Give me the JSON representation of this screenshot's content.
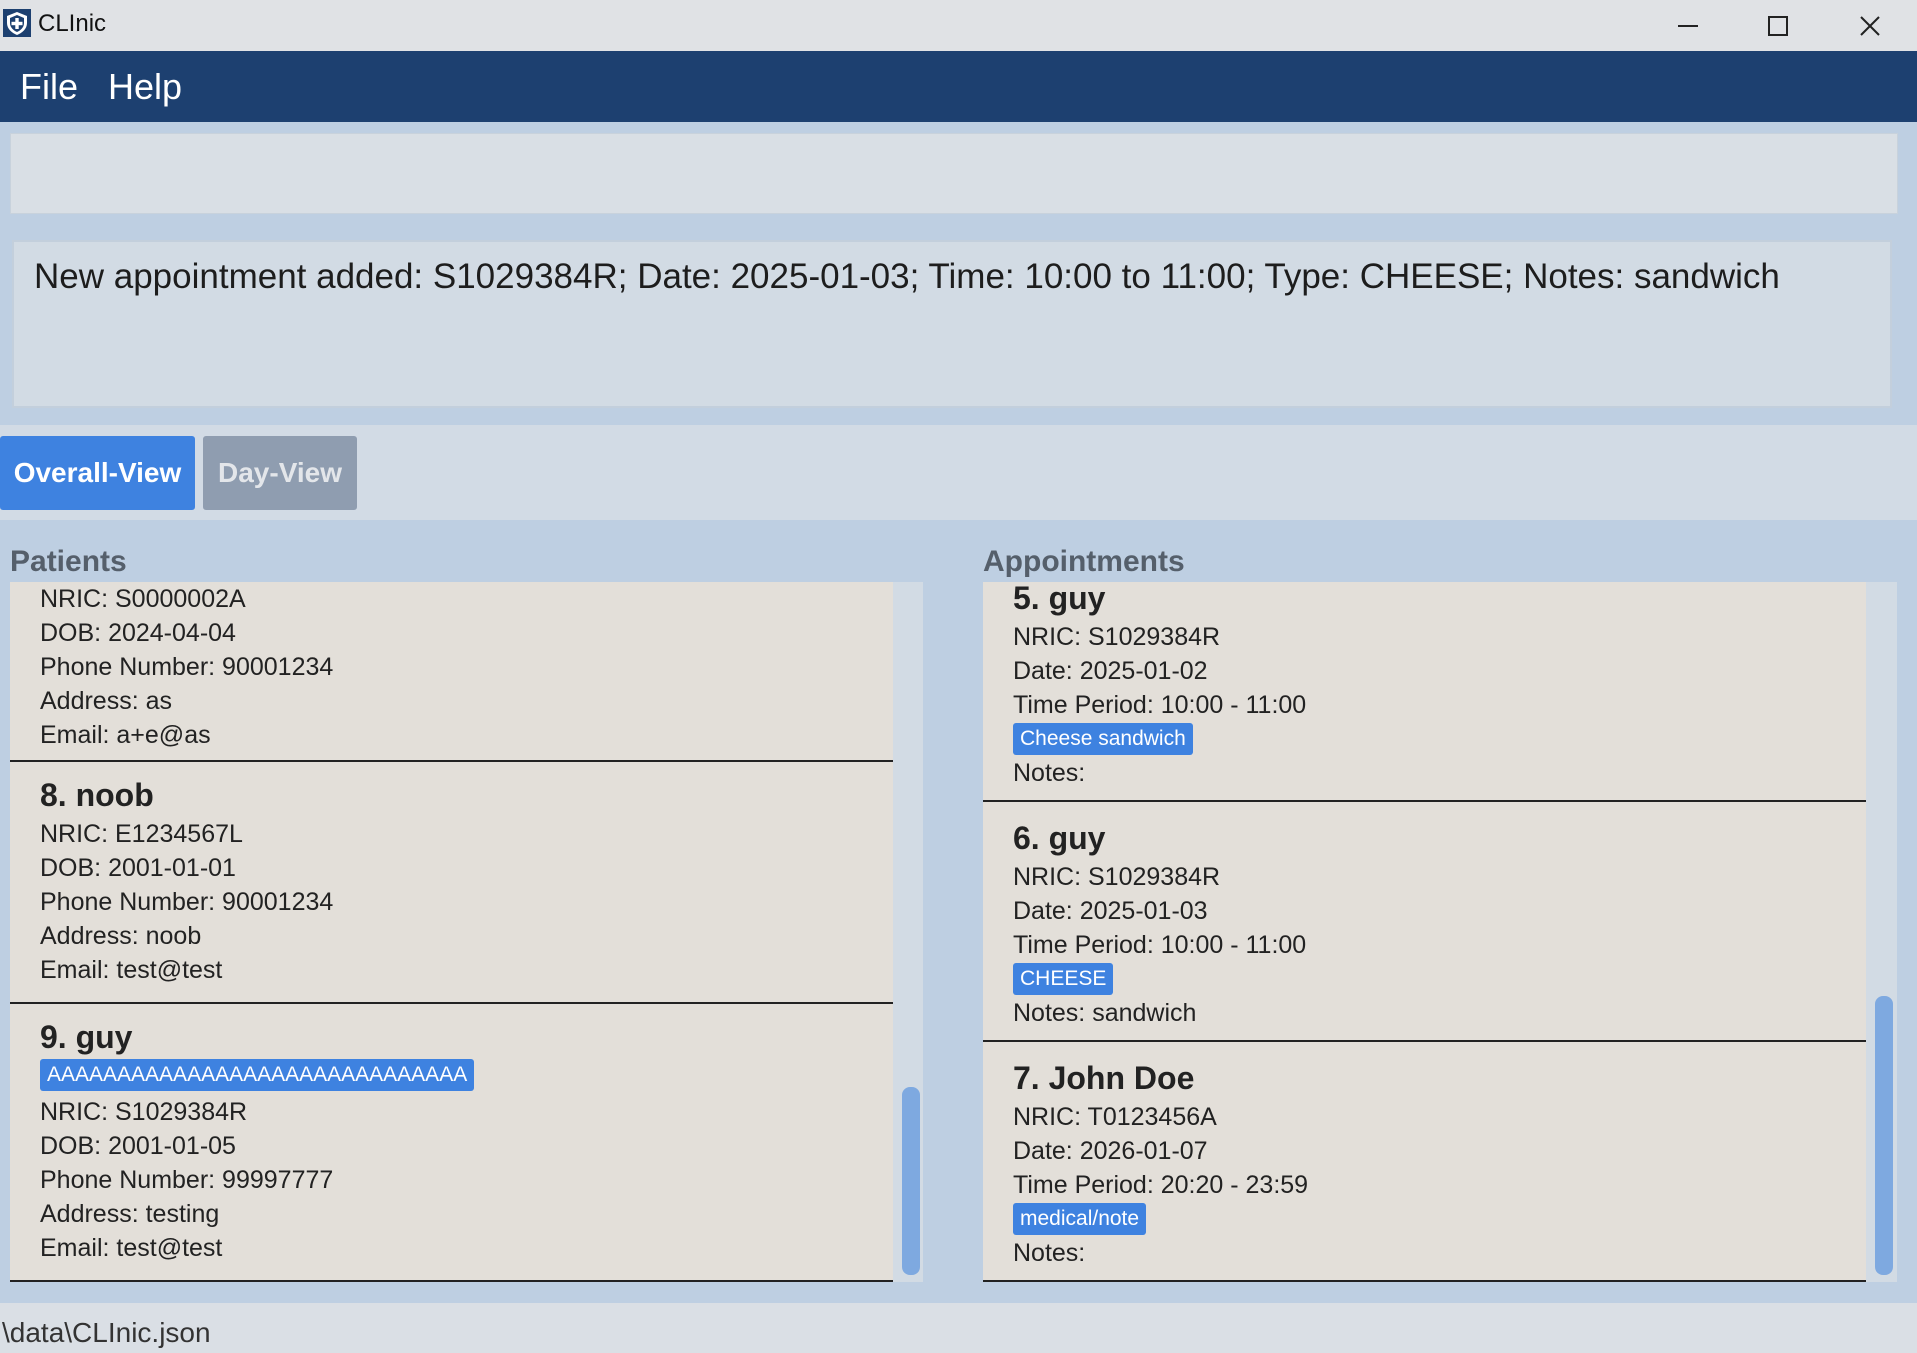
{
  "window": {
    "title": "CLInic"
  },
  "menu": {
    "file": "File",
    "help": "Help"
  },
  "command": {
    "value": ""
  },
  "result": {
    "text": "New appointment added: S1029384R; Date: 2025-01-03; Time: 10:00 to 11:00; Type: CHEESE; Notes: sandwich"
  },
  "tabs": {
    "overall": "Overall-View",
    "day": "Day-View"
  },
  "patients": {
    "title": "Patients",
    "cards": [
      {
        "head": "",
        "tag": "",
        "nric": "NRIC: S0000002A",
        "dob": "DOB: 2024-04-04",
        "phone": "Phone Number: 90001234",
        "address": "Address: as",
        "email": "Email: a+e@as"
      },
      {
        "head": "8.  noob",
        "tag": "",
        "nric": "NRIC: E1234567L",
        "dob": "DOB: 2001-01-01",
        "phone": "Phone Number: 90001234",
        "address": "Address: noob",
        "email": "Email: test@test"
      },
      {
        "head": "9.  guy",
        "tag": "AAAAAAAAAAAAAAAAAAAAAAAAAAAAAA",
        "nric": "NRIC: S1029384R",
        "dob": "DOB: 2001-01-05",
        "phone": "Phone Number: 99997777",
        "address": "Address: testing",
        "email": "Email: test@test"
      }
    ],
    "scroll_position": 0.85
  },
  "appointments": {
    "title": "Appointments",
    "cards": [
      {
        "head": "5.  guy",
        "nric": "NRIC: S1029384R",
        "date": "Date: 2025-01-02",
        "time": "Time Period: 10:00 - 11:00",
        "tag": "Cheese sandwich",
        "notes": "Notes:"
      },
      {
        "head": "6.  guy",
        "nric": "NRIC: S1029384R",
        "date": "Date: 2025-01-03",
        "time": "Time Period: 10:00 - 11:00",
        "tag": "CHEESE",
        "notes": "Notes: sandwich"
      },
      {
        "head": "7.  John Doe",
        "nric": "NRIC: T0123456A",
        "date": "Date: 2026-01-07",
        "time": "Time Period: 20:20 - 23:59",
        "tag": "medical/note",
        "notes": "Notes:"
      }
    ],
    "scroll_position": 0.75
  },
  "status": {
    "path": "\\data\\CLInic.json"
  },
  "colors": {
    "menubar": "#1d4070",
    "accent": "#3e82e0",
    "card": "#e3dfd9",
    "background": "#becfe2"
  }
}
